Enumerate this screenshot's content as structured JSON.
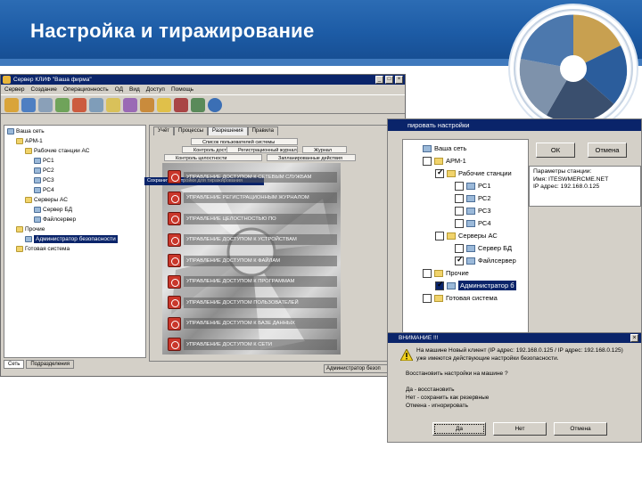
{
  "slide": {
    "title": "Настройка и тиражирование"
  },
  "main_window": {
    "title": "Сервер КЛИФ \"Ваша фирма\"",
    "menu": [
      "Сервер",
      "Создание",
      "Операционность",
      "ОД",
      "Вид",
      "Доступ",
      "Помощь"
    ],
    "tree": [
      {
        "label": "Ваша сеть",
        "level": 0,
        "icon": "network-icon"
      },
      {
        "label": "АРМ-1",
        "level": 1,
        "icon": "folder-icon"
      },
      {
        "label": "Рабочие станции АС",
        "level": 2,
        "icon": "folder-icon"
      },
      {
        "label": "РС1",
        "level": 3,
        "icon": "computer-icon"
      },
      {
        "label": "РС2",
        "level": 3,
        "icon": "computer-icon"
      },
      {
        "label": "РС3",
        "level": 3,
        "icon": "computer-icon"
      },
      {
        "label": "РС4",
        "level": 3,
        "icon": "computer-icon"
      },
      {
        "label": "Серверы АС",
        "level": 2,
        "icon": "folder-icon"
      },
      {
        "label": "Сервер БД",
        "level": 3,
        "icon": "computer-icon"
      },
      {
        "label": "Файлсервер",
        "level": 3,
        "icon": "computer-icon"
      },
      {
        "label": "Прочие",
        "level": 1,
        "icon": "folder-icon"
      },
      {
        "label": "Администратор безопасности",
        "level": 2,
        "icon": "computer-icon",
        "selected": true
      },
      {
        "label": "Готовая система",
        "level": 1,
        "icon": "folder-icon"
      }
    ],
    "bottom_tabs": [
      "Сеть",
      "Подразделения"
    ],
    "status": "Администратор безоп",
    "panel_tabs": [
      "Учёт",
      "Процессы",
      "Разрешения",
      "Правила"
    ],
    "menu_grid": [
      "Список пользователей системы",
      "Контроль доступа",
      "Регистрационный журнал",
      "Журнал",
      "Контроль целостности",
      "Запланированные действия"
    ],
    "tooltip": "Сохранить настройки для тиражирования",
    "action_rows": [
      "УПРАВЛЕНИЕ ДОСТУПОМ К СЕТЕВЫМ СЛУЖБАМ",
      "УПРАВЛЕНИЕ РЕГИСТРАЦИОННЫМ ЖУРНАЛОМ",
      "УПРАВЛЕНИЕ ЦЕЛОСТНОСТЬЮ ПО",
      "УПРАВЛЕНИЕ ДОСТУПОМ К УСТРОЙСТВАМ",
      "УПРАВЛЕНИЕ ДОСТУПОМ К ФАЙЛАМ",
      "УПРАВЛЕНИЕ ДОСТУПОМ К ПРОГРАММАМ",
      "УПРАВЛЕНИЕ ДОСТУПОМ ПОЛЬЗОВАТЕЛЕЙ",
      "УПРАВЛЕНИЕ ДОСТУПОМ К БАЗЕ ДАННЫХ",
      "УПРАВЛЕНИЕ ДОСТУПОМ К СЕТИ"
    ]
  },
  "copy_dialog": {
    "title": "пировать настройки",
    "tree": [
      {
        "label": "Ваша сеть",
        "level": 0,
        "checked": false,
        "icon": "network-icon"
      },
      {
        "label": "АРМ-1",
        "level": 1,
        "checked": false,
        "icon": "folder-icon"
      },
      {
        "label": "Рабочие станции",
        "level": 2,
        "checked": true,
        "icon": "folder-icon"
      },
      {
        "label": "РС1",
        "level": 3,
        "checked": false,
        "icon": "computer-icon"
      },
      {
        "label": "РС2",
        "level": 3,
        "checked": false,
        "icon": "computer-icon"
      },
      {
        "label": "РС3",
        "level": 3,
        "checked": false,
        "icon": "computer-icon"
      },
      {
        "label": "РС4",
        "level": 3,
        "checked": false,
        "icon": "computer-icon"
      },
      {
        "label": "Серверы АС",
        "level": 2,
        "checked": false,
        "icon": "folder-icon"
      },
      {
        "label": "Сервер БД",
        "level": 3,
        "checked": false,
        "icon": "computer-icon"
      },
      {
        "label": "Файлсервер",
        "level": 3,
        "checked": true,
        "icon": "computer-icon"
      },
      {
        "label": "Прочие",
        "level": 1,
        "checked": false,
        "icon": "folder-icon"
      },
      {
        "label": "Администратор б",
        "level": 2,
        "checked": true,
        "icon": "computer-icon",
        "selected": true
      },
      {
        "label": "Готовая система",
        "level": 1,
        "checked": false,
        "icon": "folder-icon"
      }
    ],
    "ok_label": "ОК",
    "cancel_label": "Отмена",
    "info_lines": [
      "Параметры станции:",
      "Имя: ITESWMERCME.NET",
      "IP адрес: 192.168.0.125"
    ]
  },
  "attention_dialog": {
    "title": "ВНИМАНИЕ !!!",
    "lines": [
      "На машине Новый клиент (IP адрес: 192.168.0.125 / IP адрес: 192.168.0.125)",
      "уже имеются действующие настройки безопасности.",
      "",
      "Восстановить настройки на машине ?",
      "",
      "Да - восстановить",
      "Нет - сохранить как резервные",
      "Отмена - игнорировать"
    ],
    "buttons": [
      "Да",
      "Нет",
      "Отмена"
    ]
  },
  "colors": {
    "header": "#1d5ca6",
    "titlebar": "#0a246a",
    "window_face": "#d4d0c8",
    "danger_button": "#c9362a"
  }
}
